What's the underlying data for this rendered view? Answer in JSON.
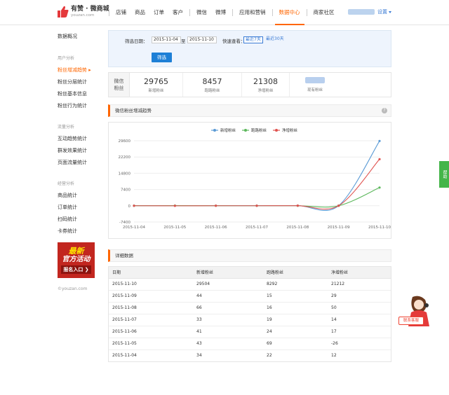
{
  "header": {
    "logo_title": "有赞 · 微商城",
    "logo_sub": "youzan.com",
    "nav": [
      "店铺",
      "商品",
      "订单",
      "客户",
      "微信",
      "微博",
      "应用和营销",
      "数据中心",
      "商家社区"
    ],
    "active_nav": "数据中心",
    "settings_label": "设置"
  },
  "sidebar": {
    "top_item": "数据概况",
    "groups": [
      {
        "title": "用户分析",
        "items": [
          "粉丝增减趋势 ▸",
          "粉丝分层统计",
          "粉丝基本信息",
          "粉丝行为统计"
        ]
      },
      {
        "title": "流量分析",
        "items": [
          "互动趋势统计",
          "群发效果统计",
          "页面流量统计"
        ]
      },
      {
        "title": "经营分析",
        "items": [
          "商品统计",
          "订单统计",
          "扫码统计",
          "卡券统计"
        ]
      }
    ],
    "promo_l1": "最新",
    "promo_l2": "官方活动",
    "promo_l3": "报名入口 ❯",
    "copyright": "©youzan.com"
  },
  "filter": {
    "label": "筛选日期：",
    "start": "2015-11-04",
    "to": "至",
    "end": "2015-11-10",
    "quick_label": "快速查看：",
    "quick_7": "最近7天",
    "quick_30": "最近30天",
    "submit": "筛选"
  },
  "stats": {
    "head_l1": "微信",
    "head_l2": "粉丝",
    "items": [
      {
        "value": "29765",
        "label": "新增粉丝"
      },
      {
        "value": "8457",
        "label": "跑路粉丝"
      },
      {
        "value": "21308",
        "label": "净增粉丝"
      },
      {
        "value": "",
        "label": "现有粉丝"
      }
    ]
  },
  "chart_section_title": "微信粉丝增减趋势",
  "table_section_title": "详细数据",
  "chart_data": {
    "type": "line",
    "x": [
      "2015-11-04",
      "2015-11-05",
      "2015-11-06",
      "2015-11-07",
      "2015-11-08",
      "2015-11-09",
      "2015-11-10"
    ],
    "series": [
      {
        "name": "新增粉丝",
        "color": "#5b9bd5",
        "values": [
          34,
          43,
          41,
          33,
          66,
          44,
          29504
        ]
      },
      {
        "name": "跑路粉丝",
        "color": "#5cb85c",
        "values": [
          22,
          69,
          24,
          19,
          16,
          15,
          8292
        ]
      },
      {
        "name": "净增粉丝",
        "color": "#e0524f",
        "values": [
          12,
          -26,
          17,
          14,
          50,
          29,
          21212
        ]
      }
    ],
    "yticks": [
      "29600",
      "22200",
      "14800",
      "7400",
      "0",
      "-7400"
    ],
    "ylim": [
      -7400,
      29600
    ],
    "legend_position": "top-center"
  },
  "table": {
    "columns": [
      "日期",
      "新增粉丝",
      "跑路粉丝",
      "净增粉丝"
    ],
    "rows": [
      [
        "2015-11-10",
        "29504",
        "8292",
        "21212"
      ],
      [
        "2015-11-09",
        "44",
        "15",
        "29"
      ],
      [
        "2015-11-08",
        "66",
        "16",
        "50"
      ],
      [
        "2015-11-07",
        "33",
        "19",
        "14"
      ],
      [
        "2015-11-06",
        "41",
        "24",
        "17"
      ],
      [
        "2015-11-05",
        "43",
        "69",
        "-26"
      ],
      [
        "2015-11-04",
        "34",
        "22",
        "12"
      ]
    ]
  },
  "widgets": {
    "side_tab": "帮助",
    "cs_label": "联系客服"
  }
}
